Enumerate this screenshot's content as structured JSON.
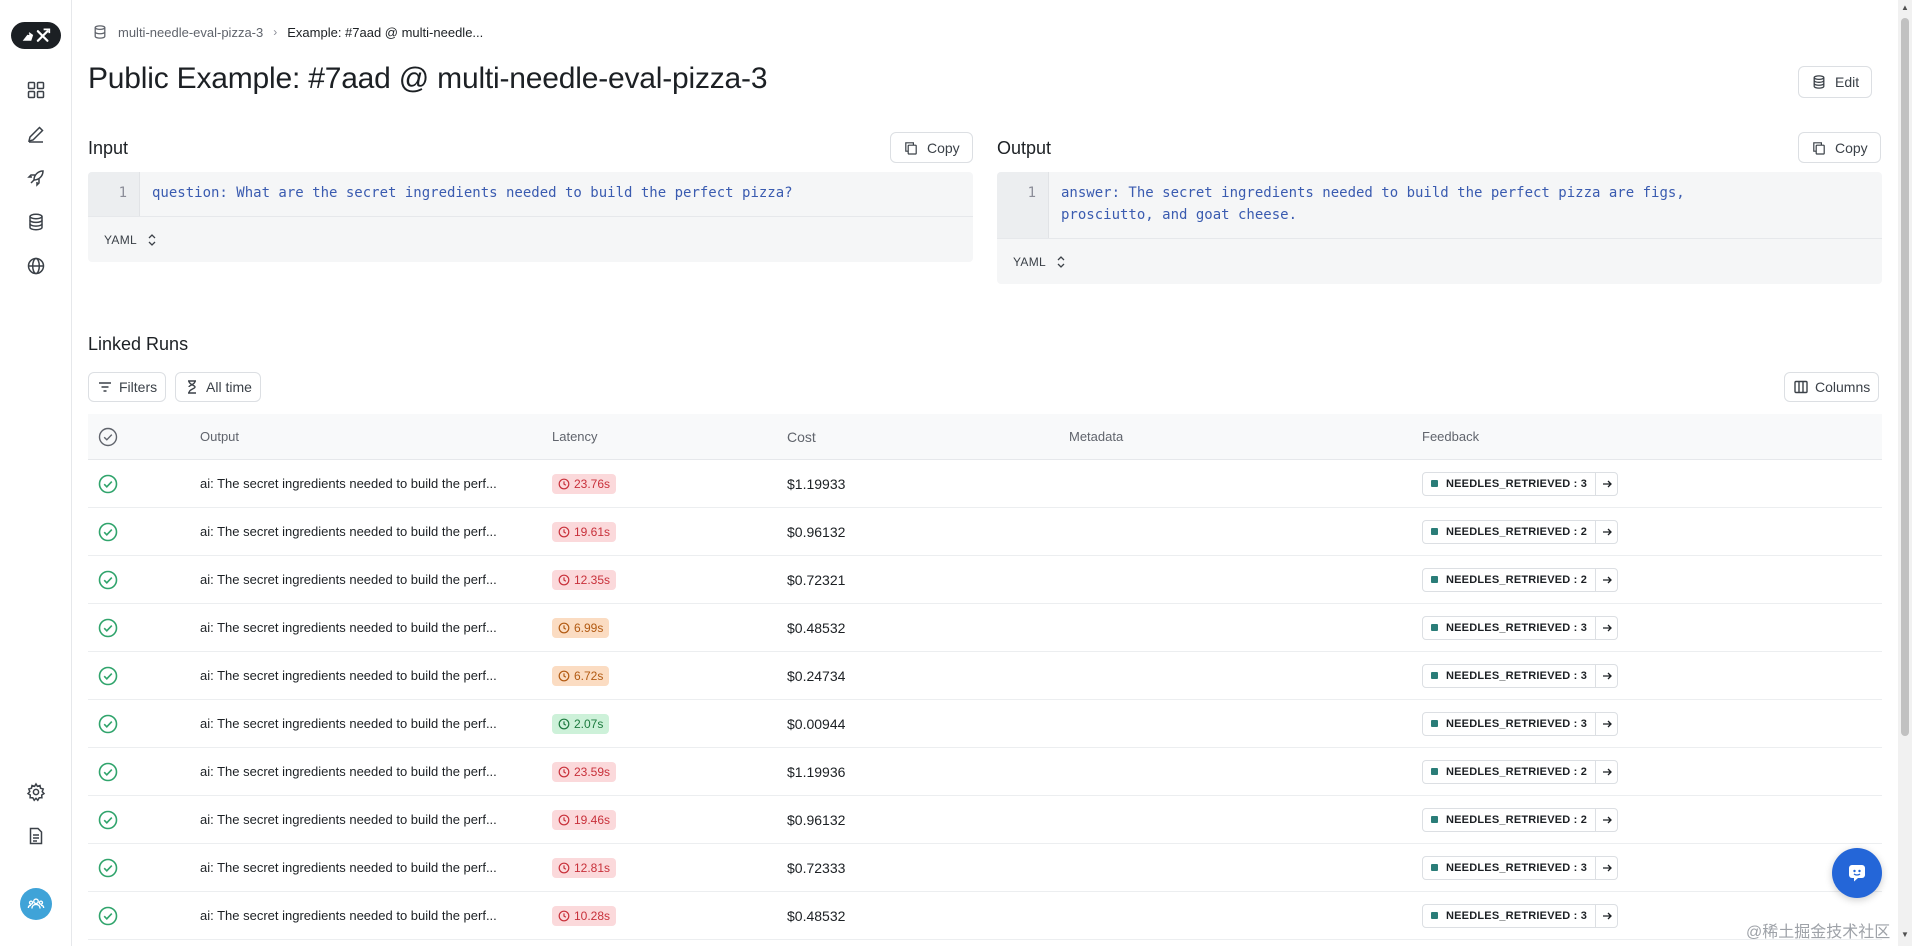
{
  "sidebar": {
    "logo_text": "🦜⚒",
    "items": [
      "grid-icon",
      "pen-icon",
      "rocket-icon",
      "database-icon",
      "globe-icon"
    ],
    "bottom": [
      "gear-icon",
      "document-icon",
      "team-icon"
    ]
  },
  "breadcrumb": {
    "dataset": "multi-needle-eval-pizza-3",
    "current": "Example: #7aad @ multi-needle..."
  },
  "page_title": "Public Example: #7aad @ multi-needle-eval-pizza-3",
  "edit_label": "Edit",
  "input": {
    "label": "Input",
    "copy_label": "Copy",
    "line_number": "1",
    "code": "question: What are the secret ingredients needed to build the perfect pizza?",
    "format": "YAML"
  },
  "output": {
    "label": "Output",
    "copy_label": "Copy",
    "line_number": "1",
    "code": "answer: The secret ingredients needed to build the perfect pizza are figs,\nprosciutto, and goat cheese.",
    "format": "YAML"
  },
  "linked_runs": {
    "title": "Linked Runs",
    "filters_label": "Filters",
    "time_label": "All time",
    "columns_label": "Columns",
    "headers": {
      "output": "Output",
      "latency": "Latency",
      "cost": "Cost",
      "metadata": "Metadata",
      "feedback": "Feedback"
    },
    "rows": [
      {
        "output": "ai: The secret ingredients needed to build the perf...",
        "latency": "23.76s",
        "latency_level": "red",
        "cost": "$1.19933",
        "feedback": "NEEDLES_RETRIEVED : 3"
      },
      {
        "output": "ai: The secret ingredients needed to build the perf...",
        "latency": "19.61s",
        "latency_level": "red",
        "cost": "$0.96132",
        "feedback": "NEEDLES_RETRIEVED : 2"
      },
      {
        "output": "ai: The secret ingredients needed to build the perf...",
        "latency": "12.35s",
        "latency_level": "red",
        "cost": "$0.72321",
        "feedback": "NEEDLES_RETRIEVED : 2"
      },
      {
        "output": "ai: The secret ingredients needed to build the perf...",
        "latency": "6.99s",
        "latency_level": "orange",
        "cost": "$0.48532",
        "feedback": "NEEDLES_RETRIEVED : 3"
      },
      {
        "output": "ai: The secret ingredients needed to build the perf...",
        "latency": "6.72s",
        "latency_level": "orange",
        "cost": "$0.24734",
        "feedback": "NEEDLES_RETRIEVED : 3"
      },
      {
        "output": "ai: The secret ingredients needed to build the perf...",
        "latency": "2.07s",
        "latency_level": "green",
        "cost": "$0.00944",
        "feedback": "NEEDLES_RETRIEVED : 3"
      },
      {
        "output": "ai: The secret ingredients needed to build the perf...",
        "latency": "23.59s",
        "latency_level": "red",
        "cost": "$1.19936",
        "feedback": "NEEDLES_RETRIEVED : 2"
      },
      {
        "output": "ai: The secret ingredients needed to build the perf...",
        "latency": "19.46s",
        "latency_level": "red",
        "cost": "$0.96132",
        "feedback": "NEEDLES_RETRIEVED : 2"
      },
      {
        "output": "ai: The secret ingredients needed to build the perf...",
        "latency": "12.81s",
        "latency_level": "red",
        "cost": "$0.72333",
        "feedback": "NEEDLES_RETRIEVED : 3"
      },
      {
        "output": "ai: The secret ingredients needed to build the perf...",
        "latency": "10.28s",
        "latency_level": "red",
        "cost": "$0.48532",
        "feedback": "NEEDLES_RETRIEVED : 3"
      }
    ]
  },
  "watermark": "@稀土掘金技术社区",
  "colors": {
    "accent_blue": "#2466d8",
    "success_green": "#30a46c",
    "feedback_dot": "#2a7d78"
  }
}
